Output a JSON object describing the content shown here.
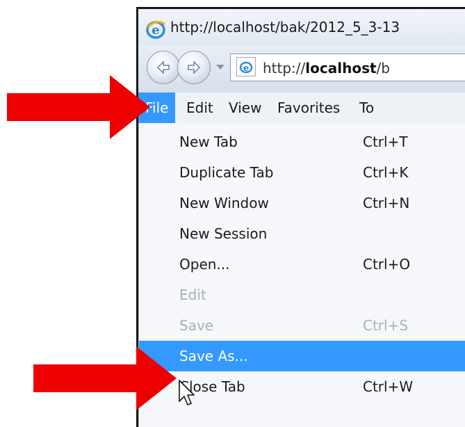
{
  "window": {
    "title": "http://localhost/bak/2012_5_3-13",
    "address": {
      "prefix": "http://",
      "host": "localhost",
      "path": "/b"
    }
  },
  "menubar": {
    "items": [
      {
        "label": "File",
        "active": true
      },
      {
        "label": "Edit"
      },
      {
        "label": "View"
      },
      {
        "label": "Favorites"
      },
      {
        "label": "To"
      }
    ]
  },
  "file_menu": {
    "items": [
      {
        "label": "New Tab",
        "shortcut": "Ctrl+T"
      },
      {
        "label": "Duplicate Tab",
        "shortcut": "Ctrl+K"
      },
      {
        "label": "New Window",
        "shortcut": "Ctrl+N"
      },
      {
        "label": "New Session",
        "shortcut": ""
      },
      {
        "label": "Open...",
        "shortcut": "Ctrl+O"
      },
      {
        "label": "Edit",
        "shortcut": "",
        "disabled": true
      },
      {
        "label": "Save",
        "shortcut": "Ctrl+S",
        "disabled": true
      },
      {
        "label": "Save As...",
        "shortcut": "",
        "highlighted": true
      },
      {
        "label": "Close Tab",
        "shortcut": "Ctrl+W"
      }
    ]
  },
  "colors": {
    "menu_highlight": "#3399ff",
    "arrow": "#ee0000",
    "disabled_text": "#a9b0ba"
  },
  "icons": {
    "title": "ie-logo-icon",
    "back": "back-arrow-icon",
    "forward": "forward-arrow-icon",
    "address": "ie-page-icon",
    "cursor": "mouse-pointer-icon",
    "annotation": "red-arrow-icon"
  }
}
